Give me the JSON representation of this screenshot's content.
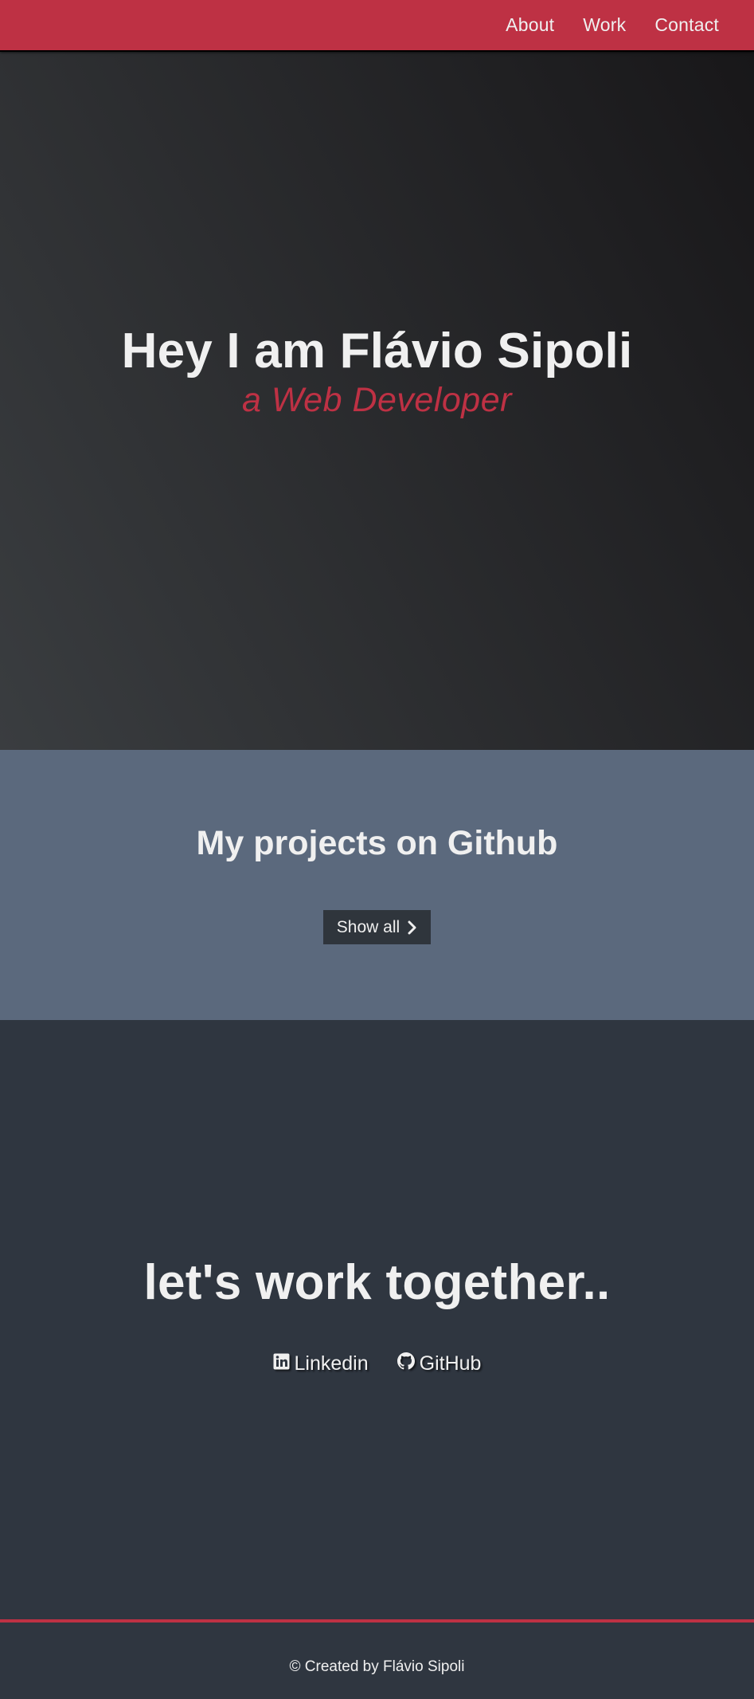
{
  "nav": {
    "items": [
      {
        "label": "About"
      },
      {
        "label": "Work"
      },
      {
        "label": "Contact"
      }
    ]
  },
  "hero": {
    "title": "Hey I am Flávio Sipoli",
    "subtitle": "a Web Developer"
  },
  "projects": {
    "title": "My projects on Github",
    "button_label": "Show all",
    "button_icon": "chevron-right-icon"
  },
  "contact": {
    "title": "let's work together..",
    "links": [
      {
        "label": "Linkedin",
        "icon": "linkedin-icon"
      },
      {
        "label": "GitHub",
        "icon": "github-icon"
      }
    ]
  },
  "footer": {
    "text": "© Created by Flávio Sipoli"
  },
  "colors": {
    "accent": "#be3144",
    "text": "#f0f0f0",
    "projects_bg": "#5b697d",
    "contact_bg": "#2f3640",
    "button_bg": "#2f353c"
  }
}
